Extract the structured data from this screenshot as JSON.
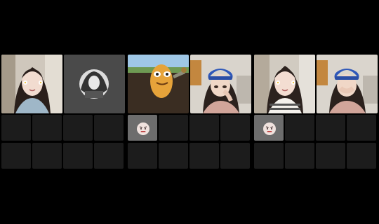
{
  "panels": [
    {
      "left_tile": {
        "desc": "person-with-flower-filter"
      },
      "right_tile": {
        "desc": "grayscale-profile-avatar"
      },
      "avatar_badge": null
    },
    {
      "left_tile": {
        "desc": "potato-character-game"
      },
      "right_tile": {
        "desc": "person-with-blue-cap"
      },
      "avatar_badge": {
        "icon": "angry-face-icon"
      }
    },
    {
      "left_tile": {
        "desc": "person-with-flower-filter"
      },
      "right_tile": {
        "desc": "person-with-blue-cap"
      },
      "avatar_badge": {
        "icon": "angry-face-icon"
      }
    }
  ],
  "colors": {
    "background": "#000000",
    "empty_cell": "#1c1c1c",
    "avatar_cell": "#6d6d6d"
  }
}
